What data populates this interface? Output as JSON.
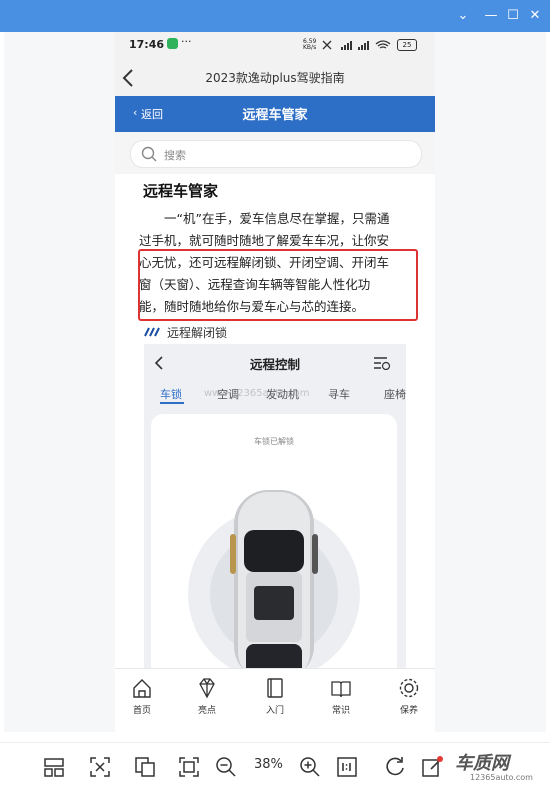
{
  "phone": {
    "time": "17:46",
    "net_speed": "6.59\nKB/s",
    "battery": "25",
    "nav_title": "2023款逸动plus驾驶指南",
    "back_label": "返回",
    "section_title": "远程车管家",
    "search_placeholder": "搜索"
  },
  "article": {
    "heading": "远程车管家",
    "lines": [
      "一“机”在手，爱车信息尽在掌握，只需通",
      "过手机，就可随时随地了解爱车车况，让你安",
      "心无忧，还可远程解闭锁、开闭空调、开闭车",
      "窗（天窗）、远程查询车辆等智能人性化功",
      "能，随时随地给你与爱车心与芯的连接。"
    ],
    "subheading": "远程解闭锁"
  },
  "remote": {
    "title": "远程控制",
    "tabs": [
      "车锁",
      "空调",
      "发动机",
      "寻车",
      "座椅"
    ],
    "status": "车锁已解锁",
    "watermark": "www.12365auto.com"
  },
  "bottom_tabs": [
    {
      "label": "首页",
      "icon": "home-icon"
    },
    {
      "label": "亮点",
      "icon": "diamond-icon"
    },
    {
      "label": "入门",
      "icon": "book-icon"
    },
    {
      "label": "常识",
      "icon": "open-book-icon"
    },
    {
      "label": "保养",
      "icon": "gear-icon"
    }
  ],
  "viewer": {
    "zoom": "38%",
    "logo_text": "车质网",
    "logo_url": "12365auto.com"
  },
  "colors": {
    "accent_blue": "#2d6ec7",
    "highlight_red": "#d33333",
    "window_blue": "#4a90e2"
  }
}
